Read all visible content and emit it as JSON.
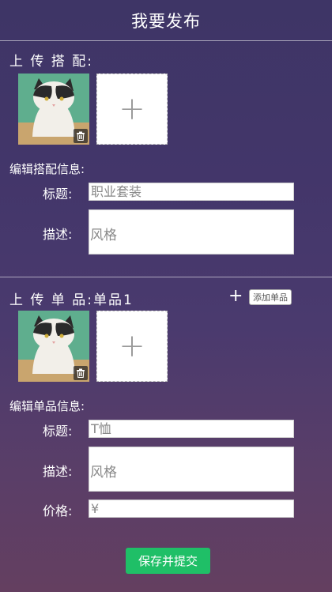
{
  "header": {
    "title": "我要发布"
  },
  "outfit": {
    "upload_label": "上 传 搭 配:",
    "images": [
      {
        "alt": "cat photo"
      }
    ],
    "edit_label": "编辑搭配信息:",
    "title_label": "标题:",
    "title_value": "职业套装",
    "desc_label": "描述:",
    "desc_value": "风格"
  },
  "item": {
    "upload_label": "上 传 单 品:单品1",
    "add_item_button": "添加单品",
    "images": [
      {
        "alt": "cat photo"
      }
    ],
    "edit_label": "编辑单品信息:",
    "title_label": "标题:",
    "title_value": "T恤",
    "desc_label": "描述:",
    "desc_value": "风格",
    "price_label": "价格:",
    "price_value": "¥"
  },
  "actions": {
    "submit_label": "保存并提交"
  },
  "colors": {
    "accent": "#1fbf67",
    "background_top": "#3e3566",
    "background_bottom": "#643f60"
  },
  "icons": {
    "delete": "trash-icon",
    "add_image": "plus-icon",
    "add_item": "plus-icon"
  }
}
